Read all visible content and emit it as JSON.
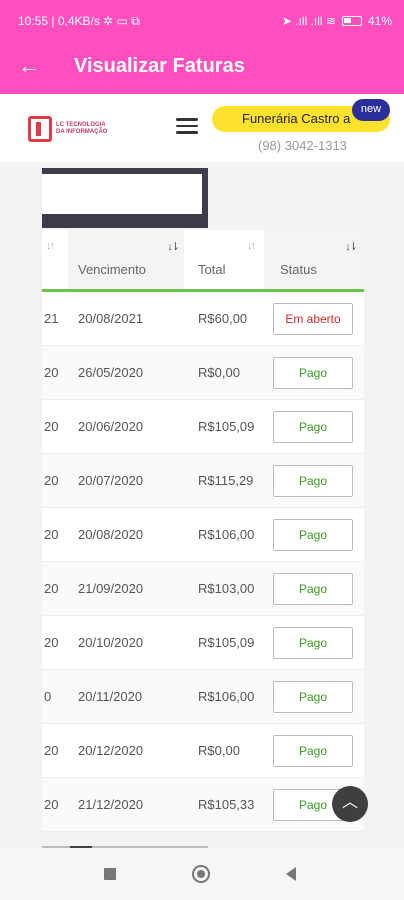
{
  "status_bar": {
    "left_text": "10:55 | 0,4KB/s ✲ ▭ ⧉",
    "right_text": "➤ .ıll .ıll ≋",
    "battery_text": "41%"
  },
  "app_bar": {
    "back_icon": "arrow-left-icon",
    "title": "Visualizar Faturas"
  },
  "header": {
    "logo_line1": "LC TECNOLOGIA",
    "logo_line2": "DA INFORMAÇÃO",
    "company": "Funerária Castro a",
    "new_badge": "new",
    "phone": "(98) 3042-1313"
  },
  "table": {
    "columns": [
      "",
      "Vencimento",
      "Total",
      "Status"
    ],
    "sort_icons": [
      "↓↑",
      "↓⇂",
      "↓↑",
      "↓⇂"
    ],
    "rows": [
      {
        "partial": "21",
        "vencimento": "20/08/2021",
        "total": "R$60,00",
        "status": "Em aberto",
        "type": "aberto"
      },
      {
        "partial": "20",
        "vencimento": "26/05/2020",
        "total": "R$0,00",
        "status": "Pago",
        "type": "pago"
      },
      {
        "partial": "20",
        "vencimento": "20/06/2020",
        "total": "R$105,09",
        "status": "Pago",
        "type": "pago"
      },
      {
        "partial": "20",
        "vencimento": "20/07/2020",
        "total": "R$115,29",
        "status": "Pago",
        "type": "pago"
      },
      {
        "partial": "20",
        "vencimento": "20/08/2020",
        "total": "R$106,00",
        "status": "Pago",
        "type": "pago"
      },
      {
        "partial": "20",
        "vencimento": "21/09/2020",
        "total": "R$103,00",
        "status": "Pago",
        "type": "pago"
      },
      {
        "partial": "20",
        "vencimento": "20/10/2020",
        "total": "R$105,09",
        "status": "Pago",
        "type": "pago"
      },
      {
        "partial": "0",
        "vencimento": "20/11/2020",
        "total": "R$106,00",
        "status": "Pago",
        "type": "pago"
      },
      {
        "partial": "20",
        "vencimento": "20/12/2020",
        "total": "R$0,00",
        "status": "Pago",
        "type": "pago"
      },
      {
        "partial": "20",
        "vencimento": "21/12/2020",
        "total": "R$105,33",
        "status": "Pago",
        "type": "pago"
      }
    ]
  },
  "fab": {
    "icon": "chevron-up-icon",
    "glyph": "︿"
  },
  "colors": {
    "brand_pink": "#ff4fbf",
    "accent_yellow": "#ffe22e",
    "badge_blue": "#2b2f9c",
    "header_underline_green": "#6cc24a",
    "paid_green": "#3a9a1f",
    "open_red": "#d42a2a"
  }
}
